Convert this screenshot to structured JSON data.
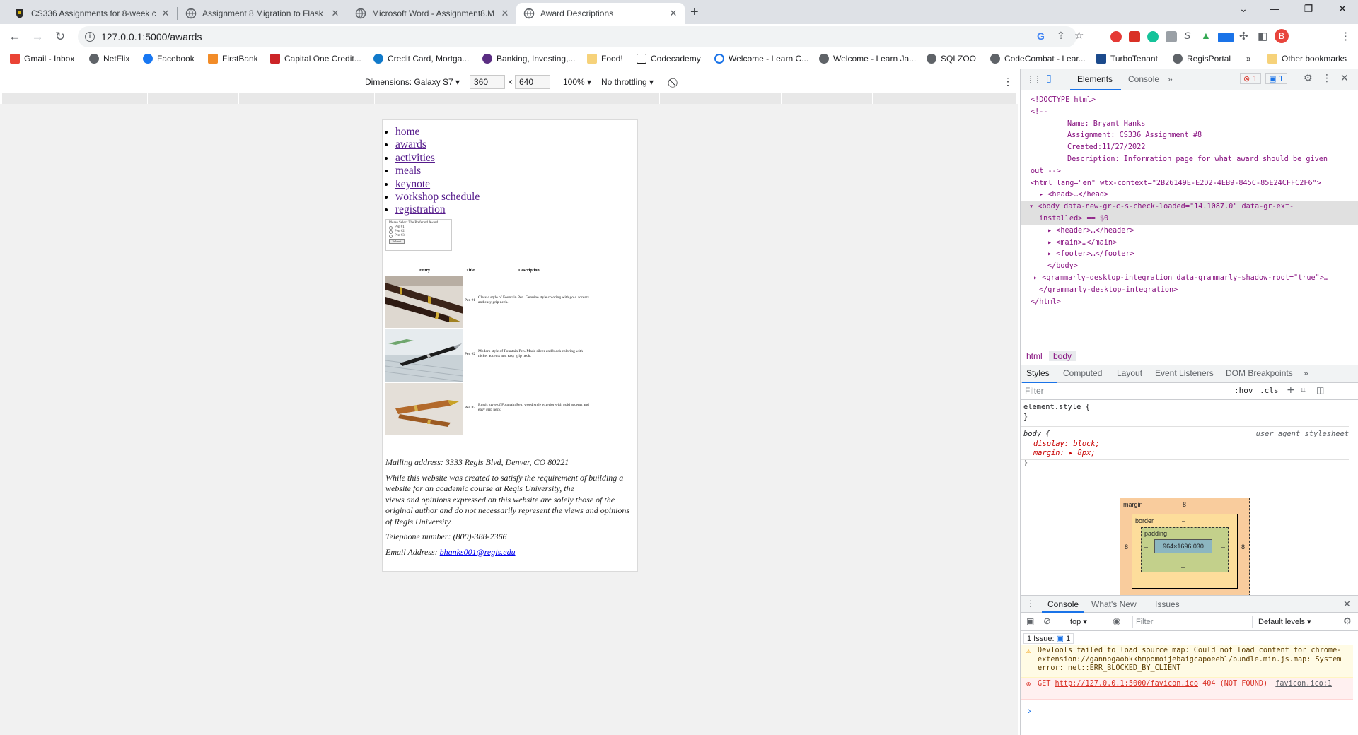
{
  "browser": {
    "tabs": [
      {
        "title": "CS336 Assignments for 8-week c",
        "active": false
      },
      {
        "title": "Assignment 8 Migration to Flask",
        "active": false
      },
      {
        "title": "Microsoft Word - Assignment8.M",
        "active": false
      },
      {
        "title": "Award Descriptions",
        "active": true
      }
    ],
    "url": "127.0.0.1:5000/awards",
    "profile_initial": "B",
    "bookmarks": [
      "Gmail - Inbox",
      "NetFlix",
      "Facebook",
      "FirstBank",
      "Capital One Credit...",
      "Credit Card, Mortga...",
      "Banking, Investing,...",
      "Food!",
      "Codecademy",
      "Welcome - Learn C...",
      "Welcome - Learn Ja...",
      "SQLZOO",
      "CodeCombat - Lear...",
      "TurboTenant",
      "RegisPortal"
    ],
    "other_bookmarks": "Other bookmarks",
    "colors": {
      "tabstrip": "#dee1e6",
      "accent": "#1a73e8",
      "link": "#551a8b",
      "profile": "#e8453c"
    }
  },
  "device_toolbar": {
    "dimensions_label": "Dimensions: Galaxy S7",
    "width": "360",
    "height": "640",
    "x": "×",
    "zoom": "100%",
    "throttling": "No throttling"
  },
  "page": {
    "nav": [
      "home",
      "awards",
      "activities",
      "meals",
      "keynote",
      "workshop schedule",
      "registration"
    ],
    "form": {
      "prompt": "Please Select The Preferred Award",
      "options": [
        "Pen #1",
        "Pen #2",
        "Pen #3"
      ],
      "submit": "Submit"
    },
    "table_headers": [
      "Entry",
      "Title",
      "Description"
    ],
    "awards": [
      {
        "title": "Pen #1",
        "description": "Classic style of Fountain Pen. Genuine style coloring with gold accents and easy grip neck."
      },
      {
        "title": "Pen #2",
        "description": "Modern style of Fountain Pen. Made silver and black coloring with nickel accents and easy grip neck."
      },
      {
        "title": "Pen #3",
        "description": "Rustic style of Fountain Pen, wood style exterior with gold accents and easy grip neck."
      }
    ],
    "footer": {
      "mailing": "Mailing address: 3333 Regis Blvd, Denver, CO 80221",
      "disclaimer_1": "While this website was created to satisfy the requirement of building a website for an academic course at Regis University, the",
      "disclaimer_2": "views and opinions expressed on this website are solely those of the original author and do not necessarily represent the views and opinions of Regis University.",
      "phone": "Telephone number: (800)-388-2366",
      "email_label": "Email Address:",
      "email": "bhanks001@regis.edu"
    }
  },
  "devtools": {
    "tabs": [
      "Elements",
      "Console"
    ],
    "error_count": "1",
    "info_count": "1",
    "dom": {
      "doctype": "<!DOCTYPE html>",
      "comment_open": "<!--",
      "comment_name": "Name: Bryant Hanks",
      "comment_assign": "Assignment: CS336 Assignment #8",
      "comment_created": "Created:11/27/2022",
      "comment_desc": "Description: Information page for what award should be given",
      "comment_close": "out -->",
      "html_open": "<html lang=\"en\" wtx-context=\"2B26149E-E2D2-4EB9-845C-85E24CFFC2F6\">",
      "head": "<head>…</head>",
      "body_open": "<body data-new-gr-c-s-check-loaded=\"14.1087.0\" data-gr-ext-",
      "body_open_2": "installed> == $0",
      "header": "<header>…</header>",
      "main": "<main>…</main>",
      "footer": "<footer>…</footer>",
      "body_close": "</body>",
      "grammarly_open": "<grammarly-desktop-integration data-grammarly-shadow-root=\"true\">…",
      "grammarly_close": "</grammarly-desktop-integration>",
      "html_close": "</html>"
    },
    "breadcrumbs": [
      "html",
      "body"
    ],
    "style_tabs": [
      "Styles",
      "Computed",
      "Layout",
      "Event Listeners",
      "DOM Breakpoints"
    ],
    "filter_placeholder": "Filter",
    "hov": ":hov",
    "cls": ".cls",
    "styles": {
      "element_style": "element.style {",
      "close": "}",
      "body_selector": "body {",
      "source": "user agent stylesheet",
      "decl_1": "display: block;",
      "decl_2": "margin: ▸ 8px;"
    },
    "box_model": {
      "margin": "margin",
      "margin_val": "8",
      "border": "border",
      "dash": "–",
      "padding": "padding",
      "content": "964×1696.030",
      "side": "8"
    },
    "drawer_tabs": [
      "Console",
      "What's New",
      "Issues"
    ],
    "console": {
      "context": "top",
      "filter_placeholder": "Filter",
      "levels": "Default levels",
      "issues": "1 Issue:",
      "issue_count": "1",
      "warning": "DevTools failed to load source map: Could not load content for chrome-extension://gannpgaobkkhmpomoijebaigcapoeebl/bundle.min.js.map: System error: net::ERR_BLOCKED_BY_CLIENT",
      "error_get": "GET",
      "error_url": "http://127.0.0.1:5000/favicon.ico",
      "error_status": "404 (NOT FOUND)",
      "error_source": "favicon.ico:1",
      "prompt": "›"
    }
  }
}
